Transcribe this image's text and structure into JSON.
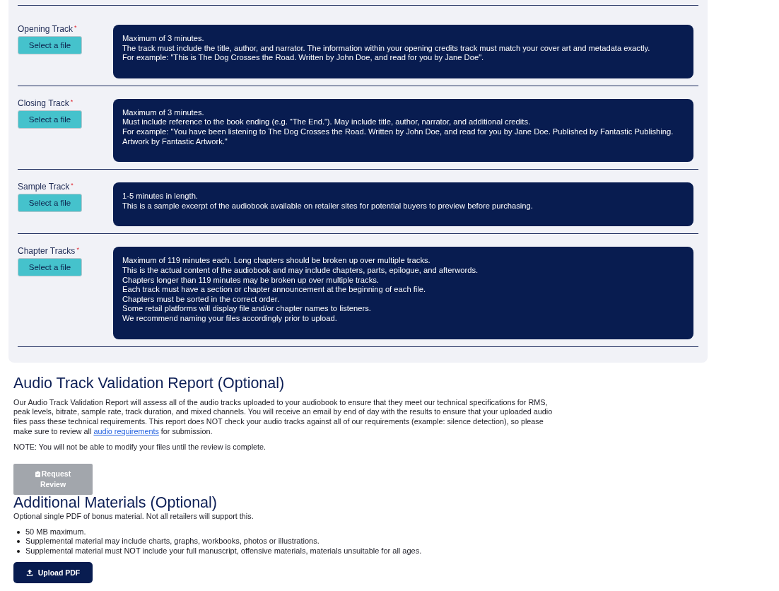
{
  "track_panel": {
    "rows": [
      {
        "label": "Opening Track",
        "required_mark": "*",
        "button": "Select a file",
        "requirements": [
          "Maximum of 3 minutes.",
          "The track must include the title, author, and narrator. The information within your opening credits track must match your cover art and metadata exactly.",
          "For example: \"This is The Dog Crosses the Road. Written by John Doe, and read for you by Jane Doe\"."
        ]
      },
      {
        "label": "Closing Track",
        "required_mark": "*",
        "button": "Select a file",
        "requirements": [
          "Maximum of 3 minutes.",
          "Must include reference to the book ending (e.g. “The End.”). May include title, author, narrator, and additional credits.",
          "For example: \"You have been listening to The Dog Crosses the Road. Written by John Doe, and read for you by Jane Doe. Published by Fantastic Publishing. Artwork by Fantastic Artwork.\""
        ]
      },
      {
        "label": "Sample Track",
        "required_mark": "*",
        "button": "Select a file",
        "requirements": [
          "1-5 minutes in length.",
          "This is a sample excerpt of the audiobook available on retailer sites for potential buyers to preview before purchasing."
        ]
      },
      {
        "label": "Chapter Tracks",
        "required_mark": "*",
        "button": "Select a file",
        "requirements": [
          "Maximum of 119 minutes each. Long chapters should be broken up over multiple tracks.",
          "This is the actual content of the audiobook and may include chapters, parts, epilogue, and afterwords.",
          "Chapters longer than 119 minutes may be broken up over multiple tracks.",
          "Each track must have a section or chapter announcement at the beginning of each file.",
          "Chapters must be sorted in the correct order.",
          "Some retail platforms will display file and/or chapter names to listeners.",
          "We recommend naming your files accordingly prior to upload."
        ]
      }
    ]
  },
  "validation_report": {
    "title": "Audio Track Validation Report (Optional)",
    "description": {
      "before": "Our Audio Track Validation Report will assess all of the audio tracks uploaded to your audiobook to ensure that they meet our technical specifications for RMS, peak levels, bitrate, sample rate, track duration, and mixed channels. You will receive an email by end of day with the results to ensure that your uploaded audio files pass these technical requirements. This report does NOT check your audio tracks against all of our requirements (example: silence detection), so please make sure to review all",
      "link": "audio requirements",
      "after": "for submission."
    },
    "note": "NOTE: You will not be able to modify your files until the review is complete.",
    "button": {
      "label": "Request Review",
      "disabled": true
    }
  },
  "additional_materials": {
    "title": "Additional Materials (Optional)",
    "description": "Optional single PDF of bonus material. Not all retailers will support this.",
    "items": [
      "50 MB maximum.",
      "Supplemental material may include charts, graphs, workbooks, photos or illustrations.",
      "Supplemental material must NOT include your full manuscript, offensive materials, materials unsuitable for all ages."
    ],
    "button": {
      "label": "Upload PDF"
    }
  }
}
